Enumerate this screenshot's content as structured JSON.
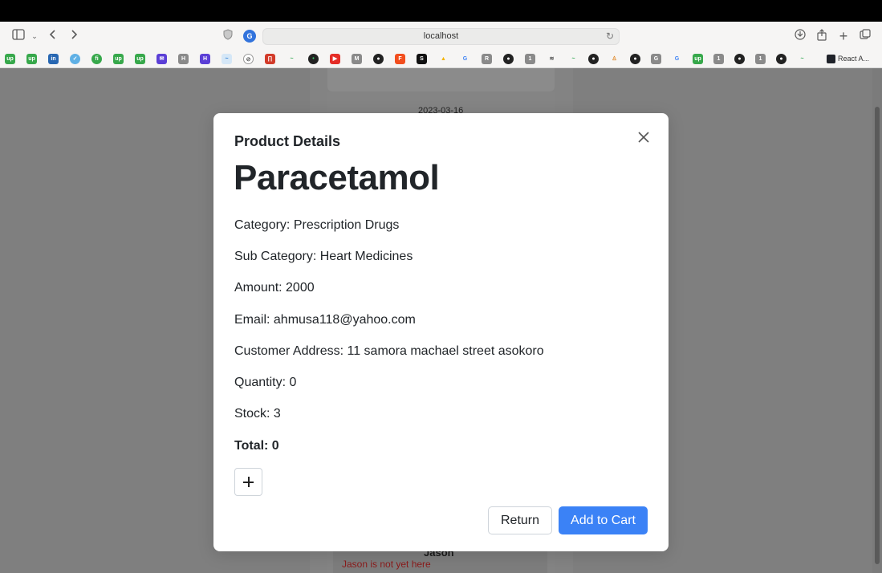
{
  "browser": {
    "url": "localhost",
    "last_bookmark": "React A..."
  },
  "background": {
    "date": "2023-03-16",
    "name": "Jason",
    "warning": "Jason is not yet here"
  },
  "modal": {
    "title": "Product Details",
    "product_name": "Paracetamol",
    "category": "Category: Prescription Drugs",
    "sub_category": "Sub Category: Heart Medicines",
    "amount": "Amount: 2000",
    "email": "Email: ahmusa118@yahoo.com",
    "address": "Customer Address: 11 samora machael street asokoro",
    "quantity": "Quantity: 0",
    "stock": "Stock: 3",
    "total": "Total: 0",
    "return_label": "Return",
    "add_to_cart_label": "Add to Cart"
  },
  "colors": {
    "primary_button": "#3b82f6",
    "overlay": "#7f7f7f",
    "warning_text": "#8b1a1a"
  }
}
